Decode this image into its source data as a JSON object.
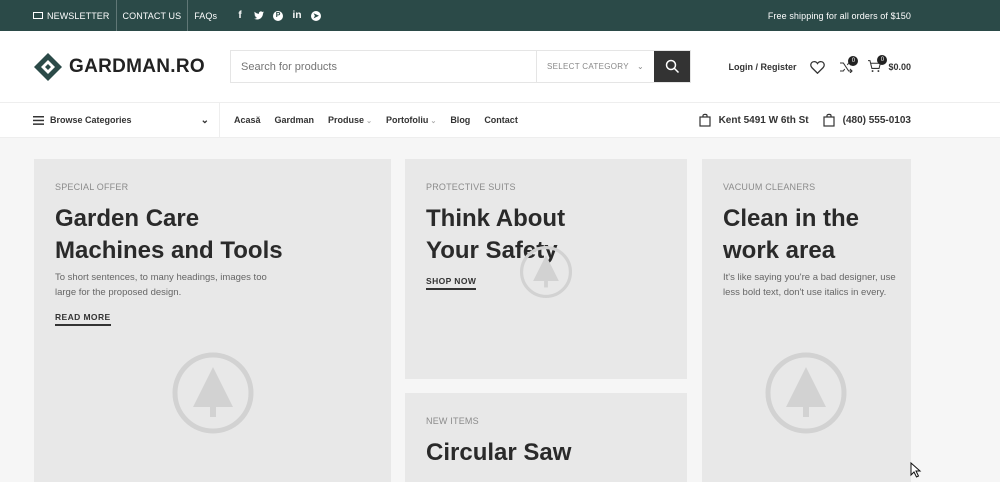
{
  "topbar": {
    "newsletter": "NEWSLETTER",
    "contact": "CONTACT US",
    "faqs": "FAQs",
    "shipping": "Free shipping for all orders of $150",
    "socials": [
      "facebook-icon",
      "twitter-icon",
      "pinterest-icon",
      "linkedin-icon",
      "telegram-icon"
    ]
  },
  "header": {
    "logo": "GARDMAN.RO",
    "search_placeholder": "Search for products",
    "category": "SELECT CATEGORY",
    "login": "Login / Register",
    "wishlist_count": "0",
    "compare_count": "0",
    "cart_total": "$0.00"
  },
  "nav": {
    "browse": "Browse Categories",
    "items": [
      "Acasă",
      "Gardman",
      "Produse",
      "Portofoliu",
      "Blog",
      "Contact"
    ],
    "address": "Kent 5491 W 6th St",
    "phone": "(480) 555-0103"
  },
  "banners": [
    {
      "label": "SPECIAL OFFER",
      "title_line1": "Garden Care",
      "title_line2": "Machines and Tools",
      "desc_line1": "To short sentences, to many headings, images too",
      "desc_line2": "large for the proposed design.",
      "cta": "READ MORE"
    },
    {
      "label": "PROTECTIVE SUITS",
      "title_line1": "Think About",
      "title_line2": "Your Safety",
      "cta": "SHOP NOW"
    },
    {
      "label": "VACUUM CLEANERS",
      "title_line1": "Clean in the",
      "title_line2": "work area",
      "desc_line1": "It's like saying you're a bad designer, use",
      "desc_line2": "less bold text, don't use italics in every."
    },
    {
      "label": "NEW ITEMS",
      "title_line1": "Circular Saw"
    }
  ],
  "colors": {
    "topbar": "#2b4a48",
    "card": "#e8e8e8"
  }
}
